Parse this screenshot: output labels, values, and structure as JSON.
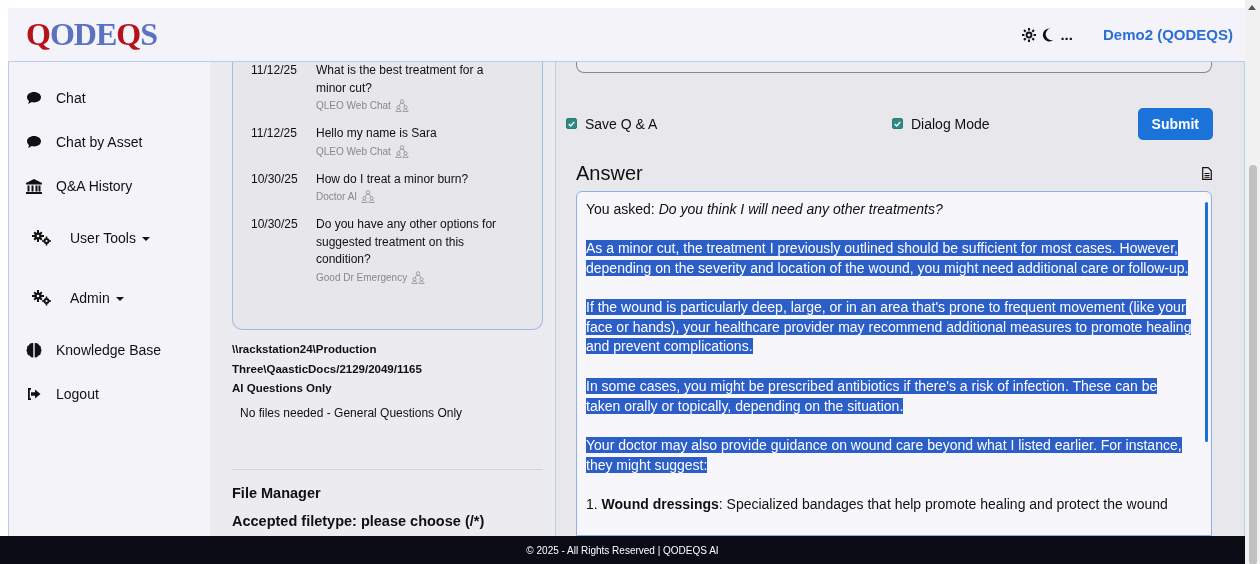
{
  "header": {
    "logo": [
      {
        "text": "Q",
        "color": "#b5121b"
      },
      {
        "text": "ODE",
        "color": "#5a72c0"
      },
      {
        "text": "Q",
        "color": "#b5121b"
      },
      {
        "text": "S",
        "color": "#5a72c0"
      }
    ],
    "more": "...",
    "user": "Demo2 (QODEQS)"
  },
  "sidebar": {
    "items": [
      {
        "label": "Chat",
        "kind": "link"
      },
      {
        "label": "Chat by Asset",
        "kind": "link"
      },
      {
        "label": "Q&A History",
        "kind": "link"
      },
      {
        "label": "User Tools",
        "kind": "dropdown"
      },
      {
        "label": "Admin",
        "kind": "dropdown"
      },
      {
        "label": "Knowledge Base",
        "kind": "link"
      },
      {
        "label": "Logout",
        "kind": "link"
      }
    ]
  },
  "history": {
    "items": [
      {
        "date": "11/12/25",
        "question": "What is the best treatment for a minor cut?",
        "source": "QLEO Web Chat"
      },
      {
        "date": "11/12/25",
        "question": "Hello my name is Sara",
        "source": "QLEO Web Chat"
      },
      {
        "date": "10/30/25",
        "question": "How do I treat a minor burn?",
        "source": "Doctor AI"
      },
      {
        "date": "10/30/25",
        "question": "Do you have any other options for suggested treatment on this condition?",
        "source": "Good Dr Emergency"
      }
    ],
    "path_lines": [
      "\\\\rackstation24\\Production",
      "Three\\QaasticDocs/2129/2049/1165"
    ],
    "mode": "AI Questions Only",
    "files_note": "No files needed - General Questions Only",
    "file_manager": "File Manager",
    "accepted": "Accepted filetype: please choose (/*)"
  },
  "form": {
    "options": [
      {
        "label": "Save Q & A",
        "checked": true
      },
      {
        "label": "Dialog Mode",
        "checked": true
      }
    ],
    "submit": "Submit"
  },
  "answer": {
    "title": "Answer",
    "asked_label": "You asked:",
    "asked": "Do you think I will need any other treatments?",
    "paragraphs": [
      {
        "text": "As a minor cut, the treatment I previously outlined should be sufficient for most cases. However, depending on the severity and location of the wound, you might need additional care or follow-up.",
        "highlighted": true
      },
      {
        "text": "If the wound is particularly deep, large, or in an area that's prone to frequent movement (like your face or hands), your healthcare provider may recommend additional measures to promote healing and prevent complications.",
        "highlighted": true
      },
      {
        "text": "In some cases, you might be prescribed antibiotics if there's a risk of infection. These can be taken orally or topically, depending on the situation.",
        "highlighted": true
      },
      {
        "text": "Your doctor may also provide guidance on wound care beyond what I listed earlier. For instance, they might suggest:",
        "highlighted": true
      },
      {
        "text": "1. **Wound dressings**: Specialized bandages that help promote healing and protect the wound",
        "highlighted": false
      }
    ]
  },
  "footer": {
    "text": "© 2025 - All Rights Reserved | QODEQS AI"
  }
}
